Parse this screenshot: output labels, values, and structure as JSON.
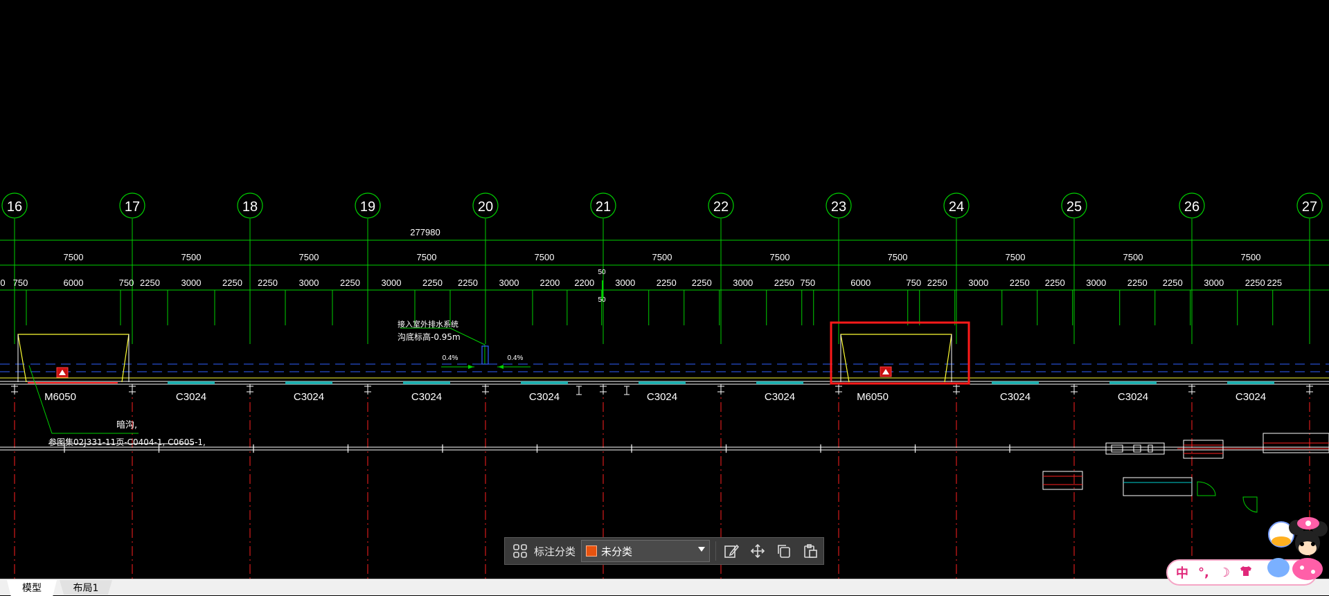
{
  "drawing": {
    "axes": [
      "16",
      "17",
      "18",
      "19",
      "20",
      "21",
      "22",
      "23",
      "24",
      "25",
      "26",
      "27"
    ],
    "total_dimension": "277980",
    "bay_dimensions": [
      "7500",
      "7500",
      "7500",
      "7500",
      "7500",
      "7500",
      "7500",
      "7500",
      "7500",
      "7500",
      "7500"
    ],
    "sub_dimensions": [
      {
        "text": "0"
      },
      {
        "text": "750"
      },
      {
        "text": "6000"
      },
      {
        "text": "750"
      },
      {
        "text": "2250"
      },
      {
        "text": "3000"
      },
      {
        "text": "2250"
      },
      {
        "text": "2250"
      },
      {
        "text": "3000"
      },
      {
        "text": "2250"
      },
      {
        "text": "3000"
      },
      {
        "text": "2250"
      },
      {
        "text": "2250"
      },
      {
        "text": "3000"
      },
      {
        "text": "2200"
      },
      {
        "text": "2200"
      },
      {
        "text": "3000"
      },
      {
        "text": "2250"
      },
      {
        "text": "2250"
      },
      {
        "text": "3000"
      },
      {
        "text": "2250"
      },
      {
        "text": "750"
      },
      {
        "text": "6000"
      },
      {
        "text": "750"
      },
      {
        "text": "2250"
      },
      {
        "text": "3000"
      },
      {
        "text": "2250"
      },
      {
        "text": "2250"
      },
      {
        "text": "3000"
      },
      {
        "text": "2250"
      },
      {
        "text": "2250"
      },
      {
        "text": "3000"
      },
      {
        "text": "2250"
      },
      {
        "text": "225"
      }
    ],
    "center_dims": [
      "50",
      "50"
    ],
    "slope_labels": [
      "0.4%",
      "0.4%"
    ],
    "note_drain_line1": "接入室外排水系统",
    "note_drain_line2": "沟底标高-0.95m",
    "note_trench_line1": "暗沟,",
    "note_trench_line2": "参图集02J331-11页-C0404-1, C0605-1,",
    "wall_labels": [
      "M6050",
      "C3024",
      "C3024",
      "C3024",
      "C3024",
      "C3024",
      "C3024",
      "M6050",
      "C3024",
      "C3024",
      "C3024"
    ],
    "colors": {
      "axis": "#00d000",
      "grid_red": "#ff2020",
      "door": "#ffff33",
      "highlight": "#ff1a1a",
      "wall": "#ffffff",
      "window": "#20b0b0",
      "dashed": "#3060ff"
    }
  },
  "toolbar": {
    "classify_label": "标注分类",
    "classify_value": "未分类",
    "classify_color": "#e8530f",
    "icons": [
      "grid-select-icon",
      "edit-annotation-icon",
      "move-icon",
      "copy-icon",
      "paste-icon"
    ]
  },
  "tabs": {
    "model": "模型",
    "layout1": "布局1"
  },
  "ime": {
    "mode": "中",
    "punct": "°,",
    "moon": "☽",
    "skin": "👕"
  }
}
